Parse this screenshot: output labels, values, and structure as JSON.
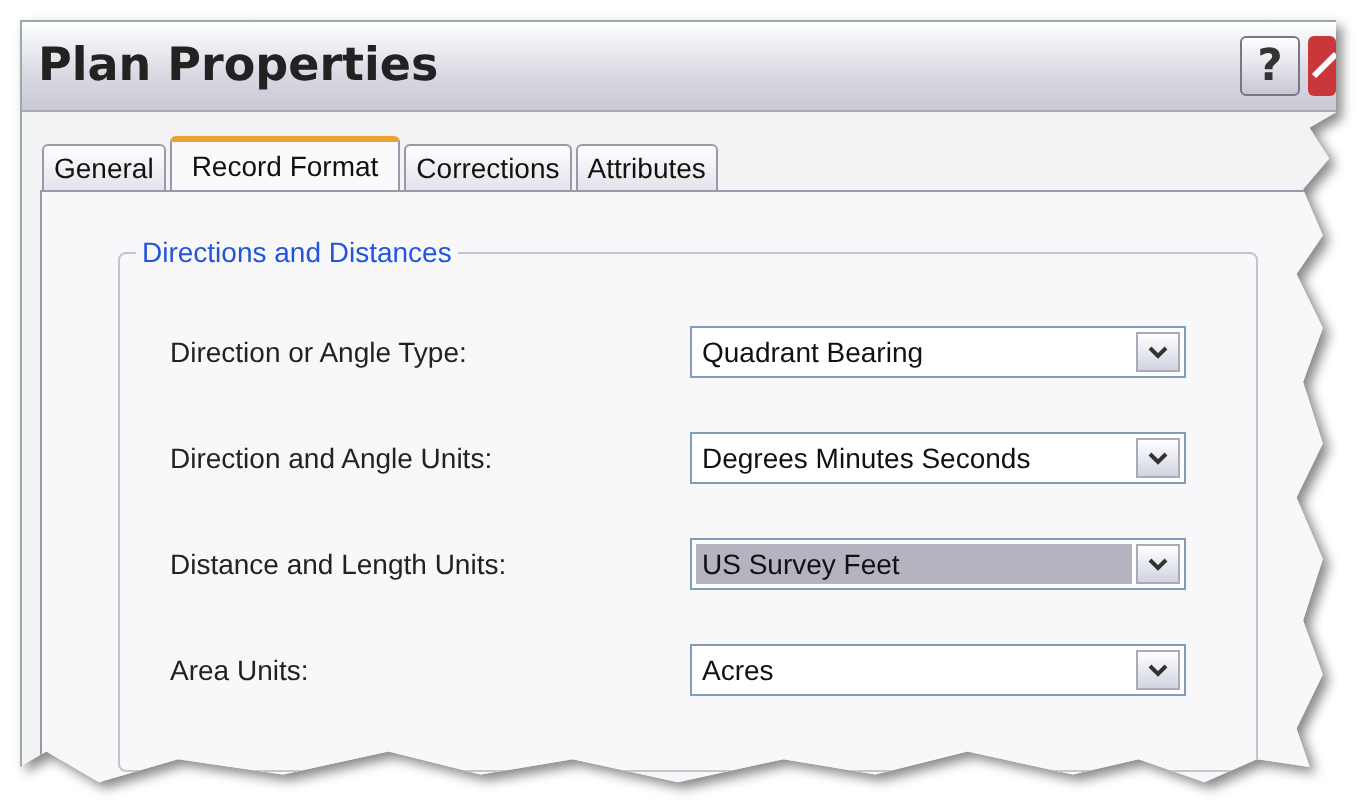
{
  "window": {
    "title": "Plan Properties",
    "help_button": "?"
  },
  "tabs": [
    {
      "label": "General",
      "selected": false
    },
    {
      "label": "Record Format",
      "selected": true
    },
    {
      "label": "Corrections",
      "selected": false
    },
    {
      "label": "Attributes",
      "selected": false
    }
  ],
  "group": {
    "title": "Directions and Distances",
    "fields": [
      {
        "label": "Direction or Angle Type:",
        "value": "Quadrant Bearing",
        "selected": false
      },
      {
        "label": "Direction and Angle Units:",
        "value": "Degrees Minutes Seconds",
        "selected": false
      },
      {
        "label": "Distance and Length Units:",
        "value": "US Survey Feet",
        "selected": true
      },
      {
        "label": "Area Units:",
        "value": "Acres",
        "selected": false
      }
    ]
  }
}
